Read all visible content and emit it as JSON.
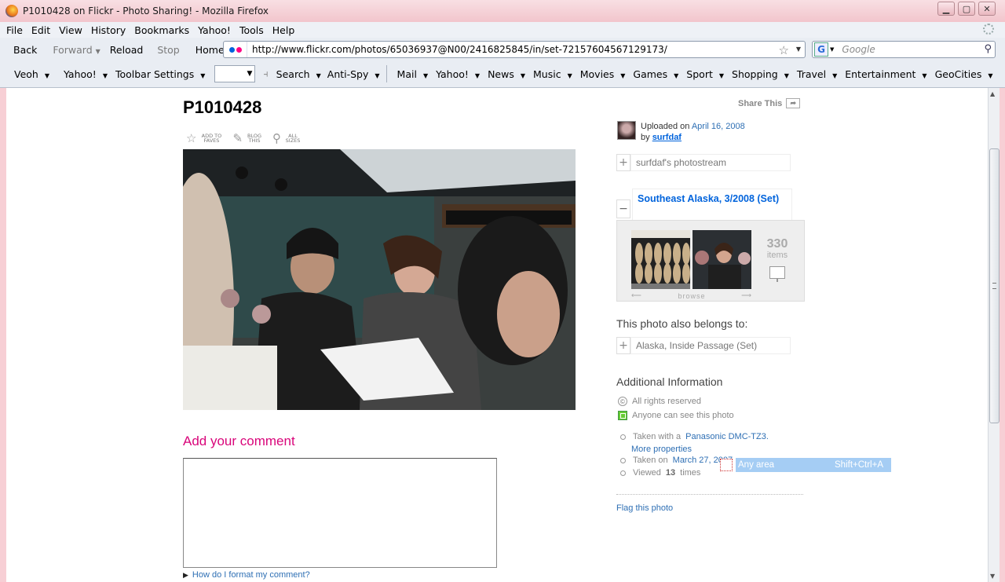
{
  "window": {
    "title": "P1010428 on Flickr - Photo Sharing! - Mozilla Firefox"
  },
  "menu": [
    "File",
    "Edit",
    "View",
    "History",
    "Bookmarks",
    "Yahoo!",
    "Tools",
    "Help"
  ],
  "nav": {
    "back": "Back",
    "forward": "Forward",
    "reload": "Reload",
    "stop": "Stop",
    "home": "Home",
    "url": "http://www.flickr.com/photos/65036937@N00/2416825845/in/set-72157604567129173/",
    "search_placeholder": "Google"
  },
  "toolbar": {
    "veoh": "Veoh",
    "yahoo": "Yahoo!",
    "toolbar_settings": "Toolbar Settings",
    "search": "Search",
    "antispy": "Anti-Spy",
    "mail": "Mail",
    "yahoo2": "Yahoo!",
    "news": "News",
    "music": "Music",
    "movies": "Movies",
    "games": "Games",
    "sport": "Sport",
    "shopping": "Shopping",
    "travel": "Travel",
    "entertainment": "Entertainment",
    "geocities": "GeoCities"
  },
  "page": {
    "title": "P1010428",
    "tools": {
      "faves": "ADD TO FAVES",
      "blog": "BLOG THIS",
      "sizes": "ALL SIZES"
    },
    "share": "Share This",
    "uploaded_prefix": "Uploaded on",
    "uploaded_date": "April 16, 2008",
    "by_prefix": "by",
    "username": "surfdaf",
    "photostream": "surfdaf's photostream",
    "set": {
      "title": "Southeast Alaska, 3/2008 (Set)",
      "count": "330",
      "items_label": "items",
      "browse": "browse"
    },
    "belongs_label": "This photo also belongs to:",
    "other_set": "Alaska, Inside Passage (Set)",
    "additional_info": "Additional Information",
    "rights": "All rights reserved",
    "visibility": "Anyone can see this photo",
    "camera_prefix": "Taken with a",
    "camera": "Panasonic DMC-TZ3.",
    "more_properties": "More properties",
    "taken_prefix": "Taken on",
    "taken_date": "March 27, 2007",
    "viewed_prefix": "Viewed",
    "viewed_count": "13",
    "viewed_suffix": "times",
    "flag": "Flag this photo",
    "add_comment": "Add your comment",
    "format_help": "How do I format my comment?"
  },
  "tooltip": {
    "label": "Any area",
    "shortcut": "Shift+Ctrl+A"
  },
  "colors": {
    "flickr_blue": "#0063dc",
    "flickr_pink": "#ff0084",
    "comment_heading": "#d9057a"
  }
}
